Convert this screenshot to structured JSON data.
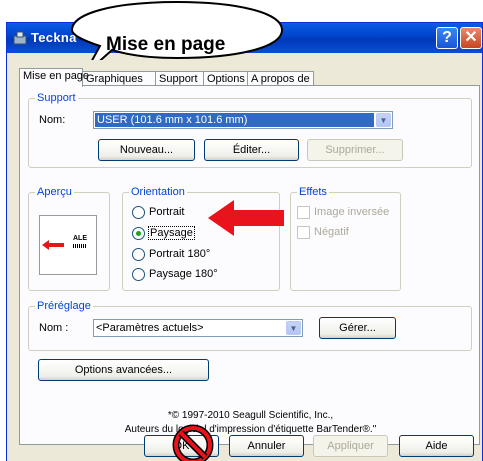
{
  "window": {
    "title": "Teckna",
    "help_glyph": "?",
    "close_glyph": "✕"
  },
  "callout": {
    "text": "Mise en page"
  },
  "tabs": [
    {
      "label": "Mise en page",
      "active": true
    },
    {
      "label": "Graphiques"
    },
    {
      "label": "Support"
    },
    {
      "label": "Options"
    },
    {
      "label": "A propos de"
    }
  ],
  "support": {
    "legend": "Support",
    "nom_label": "Nom:",
    "nom_value": "USER (101.6 mm x 101.6 mm)",
    "nouveau_button": "Nouveau...",
    "editer_button": "Éditer...",
    "supprimer_button": "Supprimer..."
  },
  "apercu": {
    "legend": "Aperçu",
    "label_text": "ALE"
  },
  "orientation": {
    "legend": "Orientation",
    "options": [
      "Portrait",
      "Paysage",
      "Portrait 180°",
      "Paysage 180°"
    ],
    "selected": "Paysage"
  },
  "effets": {
    "legend": "Effets",
    "options": [
      "Image inversée",
      "Négatif"
    ]
  },
  "prereglage": {
    "legend": "Préréglage",
    "nom_label": "Nom :",
    "nom_value": "<Paramètres actuels>",
    "gerer_button": "Gérer..."
  },
  "options_avancees_button": "Options avancées...",
  "copyright": {
    "line1": "*© 1997-2010 Seagull Scientific, Inc.,",
    "line2": "Auteurs du logiciel d'impression d'étiquette BarTender®.\""
  },
  "footer": {
    "ok_button": "OK",
    "annuler_button": "Annuler",
    "appliquer_button": "Appliquer",
    "aide_button": "Aide"
  },
  "colors": {
    "annotation_red": "#e8131b",
    "title_blue": "#0043c9",
    "legend_blue": "#0046d5"
  }
}
